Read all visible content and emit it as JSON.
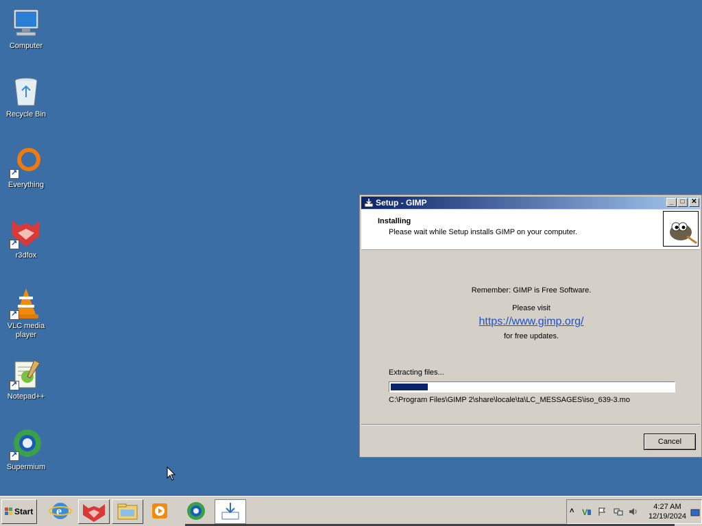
{
  "desktop": {
    "icons": [
      {
        "label": "Computer",
        "icon": "computer-icon"
      },
      {
        "label": "Recycle Bin",
        "icon": "recycle-bin-icon"
      },
      {
        "label": "Everything",
        "icon": "everything-icon"
      },
      {
        "label": "r3dfox",
        "icon": "r3dfox-icon"
      },
      {
        "label": "VLC media player",
        "icon": "vlc-icon"
      },
      {
        "label": "Notepad++",
        "icon": "notepad-plus-plus-icon"
      },
      {
        "label": "Supermium",
        "icon": "supermium-icon"
      }
    ]
  },
  "dialog": {
    "title": "Setup - GIMP",
    "header_title": "Installing",
    "header_subtitle": "Please wait while Setup installs GIMP on your computer.",
    "remember": "Remember: GIMP is Free Software.",
    "visit": "Please visit",
    "link": "https://www.gimp.org/",
    "updates": "for free updates.",
    "status": "Extracting files...",
    "progress_percent": 13,
    "filepath": "C:\\Program Files\\GIMP 2\\share\\locale\\ta\\LC_MESSAGES\\iso_639-3.mo",
    "cancel_label": "Cancel"
  },
  "taskbar": {
    "start_label": "Start",
    "apps": [
      "internet-explorer-icon",
      "r3dfox-icon",
      "file-explorer-icon",
      "media-player-icon",
      "supermium-icon",
      "setup-icon"
    ],
    "time": "4:27 AM",
    "date": "12/19/2024"
  },
  "colors": {
    "desktop": "#3a6ea5",
    "titlebar_start": "#0a246a",
    "titlebar_end": "#a6caf0",
    "progress": "#0a246a",
    "link": "#1a4fd6"
  }
}
